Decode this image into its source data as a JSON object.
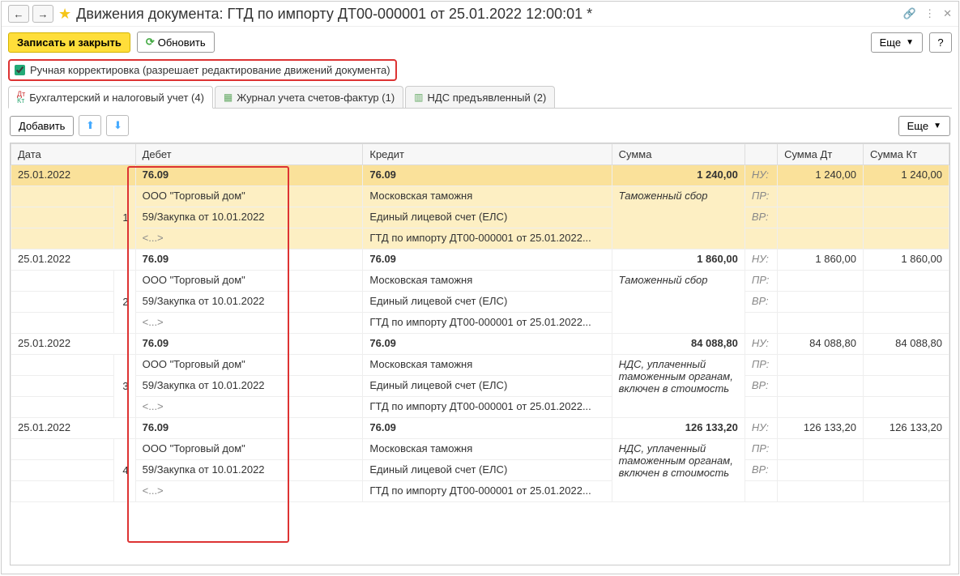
{
  "title": "Движения документа: ГТД по импорту ДТ00-000001 от 25.01.2022 12:00:01 *",
  "toolbar": {
    "save_close": "Записать и закрыть",
    "refresh": "Обновить",
    "more": "Еще",
    "help": "?"
  },
  "checkbox_label": "Ручная корректировка (разрешает редактирование движений документа)",
  "tabs": [
    {
      "label": "Бухгалтерский и налоговый учет (4)"
    },
    {
      "label": "Журнал учета счетов-фактур (1)"
    },
    {
      "label": "НДС предъявленный (2)"
    }
  ],
  "sub_toolbar": {
    "add": "Добавить",
    "more": "Еще"
  },
  "columns": {
    "date": "Дата",
    "debit": "Дебет",
    "credit": "Кредит",
    "sum": "Сумма",
    "sumdt": "Сумма Дт",
    "sumkt": "Сумма Кт"
  },
  "labels": {
    "nu": "НУ:",
    "pr": "ПР:",
    "vr": "ВР:"
  },
  "rows": [
    {
      "n": "1",
      "date": "25.01.2022",
      "debit": {
        "acc": "76.09",
        "l1": "ООО \"Торговый дом\"",
        "l2": "59/Закупка от 10.01.2022",
        "l3": "<...>"
      },
      "credit": {
        "acc": "76.09",
        "l1": "Московская таможня",
        "l2": "Единый лицевой счет (ЕЛС)",
        "l3": "ГТД по импорту ДТ00-000001 от 25.01.2022..."
      },
      "sum": "1 240,00",
      "sumnote": "Таможенный сбор",
      "sumdt": "1 240,00",
      "sumkt": "1 240,00"
    },
    {
      "n": "2",
      "date": "25.01.2022",
      "debit": {
        "acc": "76.09",
        "l1": "ООО \"Торговый дом\"",
        "l2": "59/Закупка от 10.01.2022",
        "l3": "<...>"
      },
      "credit": {
        "acc": "76.09",
        "l1": "Московская таможня",
        "l2": "Единый лицевой счет (ЕЛС)",
        "l3": "ГТД по импорту ДТ00-000001 от 25.01.2022..."
      },
      "sum": "1 860,00",
      "sumnote": "Таможенный сбор",
      "sumdt": "1 860,00",
      "sumkt": "1 860,00"
    },
    {
      "n": "3",
      "date": "25.01.2022",
      "debit": {
        "acc": "76.09",
        "l1": "ООО \"Торговый дом\"",
        "l2": "59/Закупка от 10.01.2022",
        "l3": "<...>"
      },
      "credit": {
        "acc": "76.09",
        "l1": "Московская таможня",
        "l2": "Единый лицевой счет (ЕЛС)",
        "l3": "ГТД по импорту ДТ00-000001 от 25.01.2022..."
      },
      "sum": "84 088,80",
      "sumnote": "НДС, уплаченный таможенным органам, включен в стоимость",
      "sumdt": "84 088,80",
      "sumkt": "84 088,80"
    },
    {
      "n": "4",
      "date": "25.01.2022",
      "debit": {
        "acc": "76.09",
        "l1": "ООО \"Торговый дом\"",
        "l2": "59/Закупка от 10.01.2022",
        "l3": "<...>"
      },
      "credit": {
        "acc": "76.09",
        "l1": "Московская таможня",
        "l2": "Единый лицевой счет (ЕЛС)",
        "l3": "ГТД по импорту ДТ00-000001 от 25.01.2022..."
      },
      "sum": "126 133,20",
      "sumnote": "НДС, уплаченный таможенным органам, включен в стоимость",
      "sumdt": "126 133,20",
      "sumkt": "126 133,20"
    }
  ]
}
